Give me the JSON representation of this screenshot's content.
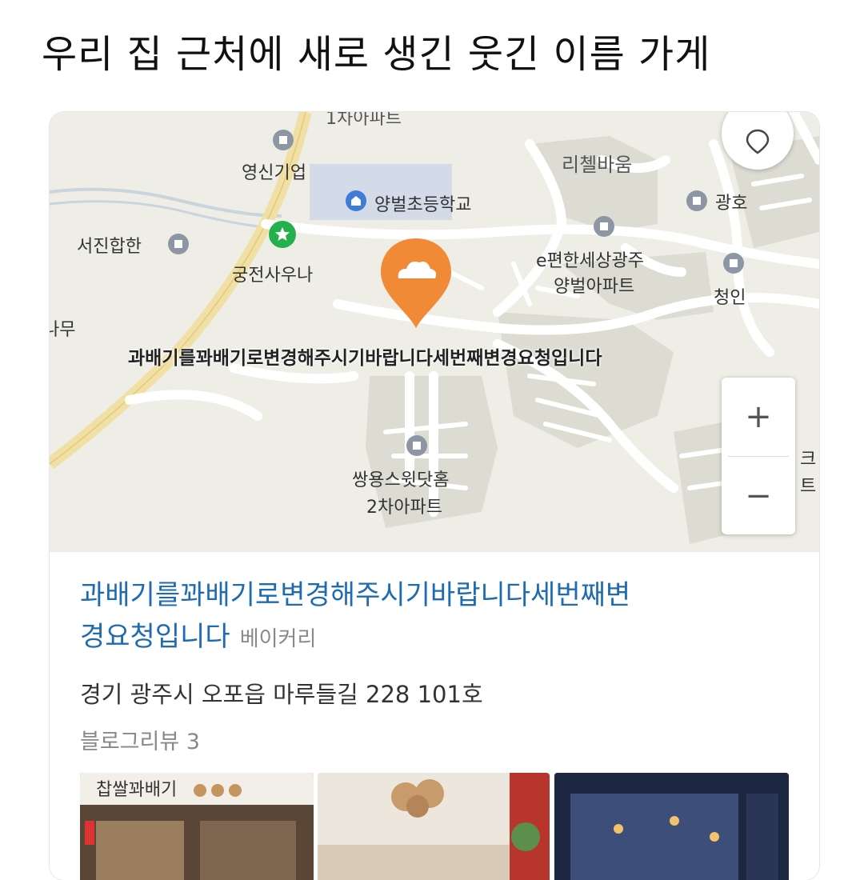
{
  "headline": "우리 집 근처에 새로 생긴 웃긴 이름 가게",
  "map": {
    "labels": {
      "top_apartment": "1차아파트",
      "youngshin": "영신기업",
      "school": "양벌초등학교",
      "richel": "리첼바움",
      "gwangho": "광호",
      "seojin": "서진합한",
      "sauna": "궁전사우나",
      "epyeon_1": "e편한세상광주",
      "epyeon_2": "양벌아파트",
      "cheongin": "청인",
      "namu": "나무",
      "ssangyong_1": "쌍용스윗닷홈",
      "ssangyong_2": "2차아파트",
      "edge_1": "크",
      "edge_2": "트"
    },
    "store_label": "과배기를꽈배기로변경해주시기바랍니다세번째변경요청입니다",
    "pin_color": "#f08a36",
    "zoom_in": "+",
    "zoom_out": "−"
  },
  "place": {
    "name_line1": "과배기를꽈배기로변경해주시기바랍니다세번째변",
    "name_line2": "경요청입니다",
    "category": "베이커리",
    "address": "경기 광주시 오포읍 마루들길 228 101호",
    "reviews": "블로그리뷰 3",
    "link_color": "#1e6bb2"
  },
  "photos": {
    "sign_text": "찹쌀꽈배기"
  }
}
